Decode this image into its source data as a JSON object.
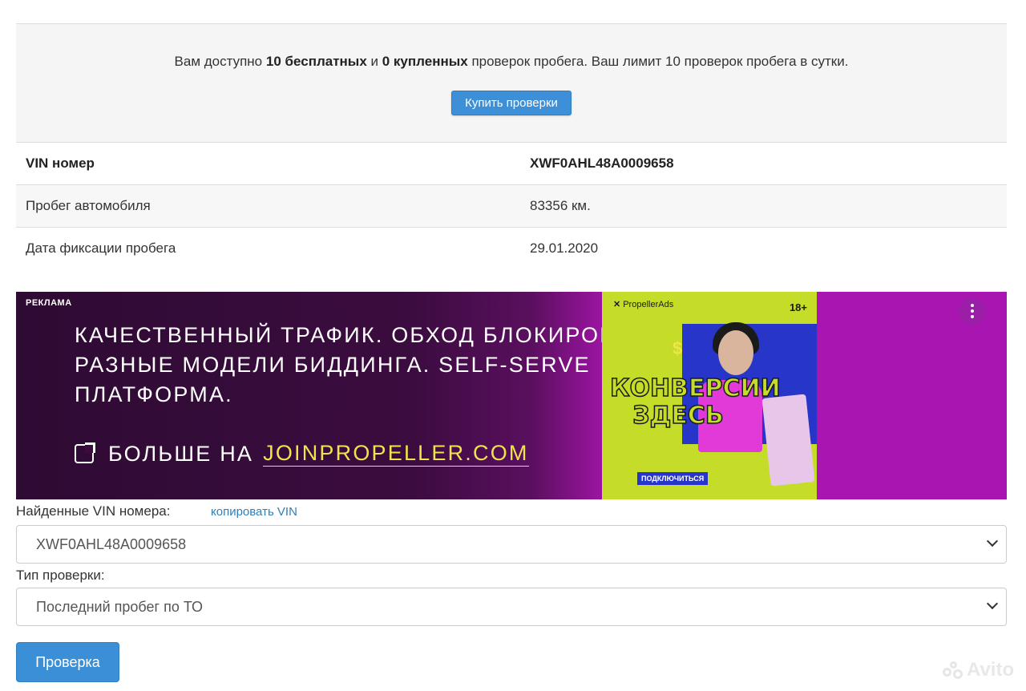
{
  "info": {
    "text_prefix": "Вам доступно",
    "free_count": "10 бесплатных",
    "text_and": "и",
    "bought_count": "0 купленных",
    "text_suffix": "проверок пробега. Ваш лимит 10 проверок пробега в сутки.",
    "buy_button": "Купить проверки"
  },
  "table": {
    "rows": [
      {
        "label": "VIN номер",
        "value": "XWF0AHL48A0009658"
      },
      {
        "label": "Пробег автомобиля",
        "value": "83356 км."
      },
      {
        "label": "Дата фиксации пробега",
        "value": "29.01.2020"
      }
    ]
  },
  "ad": {
    "label": "РЕКЛАМА",
    "headline": "Качественный трафик. Обход блокировок. Разные модели биддинга. Self-serve платформа.",
    "cta_prefix": "Больше на",
    "cta_domain": "JOINPROPELLER.COM",
    "brand": "PropellerAds",
    "age": "18+",
    "image_title": "Конверсии здесь",
    "image_button": "ПОДКЛЮЧИТЬСЯ",
    "menu_icon": "more-vertical-icon"
  },
  "form": {
    "found_label": "Найденные VIN номера:",
    "copy_link": "копировать VIN",
    "vin_selected": "XWF0AHL48A0009658",
    "type_label": "Тип проверки:",
    "type_selected": "Последний пробег по ТО",
    "submit": "Проверка"
  },
  "watermark": "Avito",
  "colors": {
    "primary": "#3b8fd6",
    "link": "#2f7fb8",
    "ad_background": "#3b0c3f",
    "ad_accent": "#a815b0",
    "ad_domain": "#f0e44a"
  }
}
